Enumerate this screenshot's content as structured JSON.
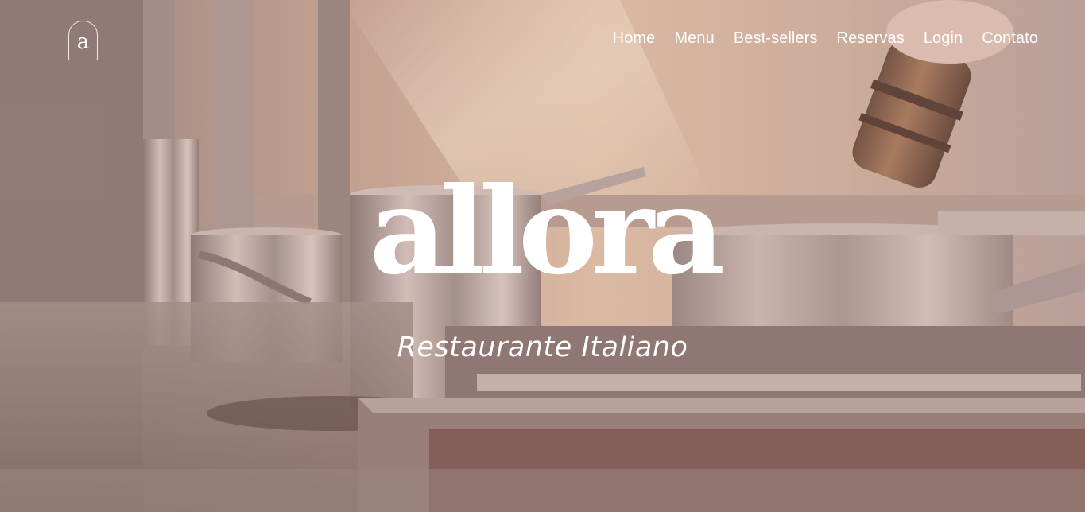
{
  "logo": {
    "letter": "a"
  },
  "nav": {
    "items": [
      "Home",
      "Menu",
      "Best-sellers",
      "Reservas",
      "Login",
      "Contato"
    ]
  },
  "hero": {
    "brand_name": "allora",
    "tagline": "Restaurante Italiano"
  },
  "colors": {
    "text": "#ffffff",
    "overlay": "#be9691"
  }
}
